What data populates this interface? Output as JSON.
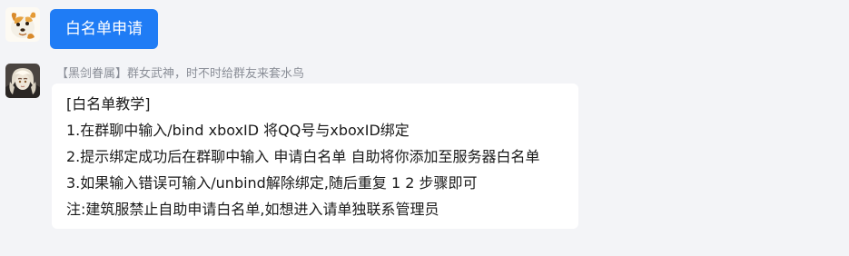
{
  "messages": [
    {
      "avatar_icon": "dog-avatar-icon",
      "text": "白名单申请"
    },
    {
      "avatar_icon": "anime-character-avatar-icon",
      "sender": "【黑剑眷属】群女武神，时不时给群友来套水鸟",
      "lines": [
        "[白名单教学]",
        "1.在群聊中输入/bind xboxID 将QQ号与xboxID绑定",
        "2.提示绑定成功后在群聊中输入 申请白名单 自助将你添加至服务器白名单",
        "3.如果输入错误可输入/unbind解除绑定,随后重复 1 2 步骤即可",
        "注:建筑服禁止自助申请白名单,如想进入请单独联系管理员"
      ]
    }
  ],
  "colors": {
    "background": "#f3f4f7",
    "self_bubble": "#1f7cf5",
    "other_bubble": "#ffffff",
    "sender_text": "#8b8f98"
  }
}
